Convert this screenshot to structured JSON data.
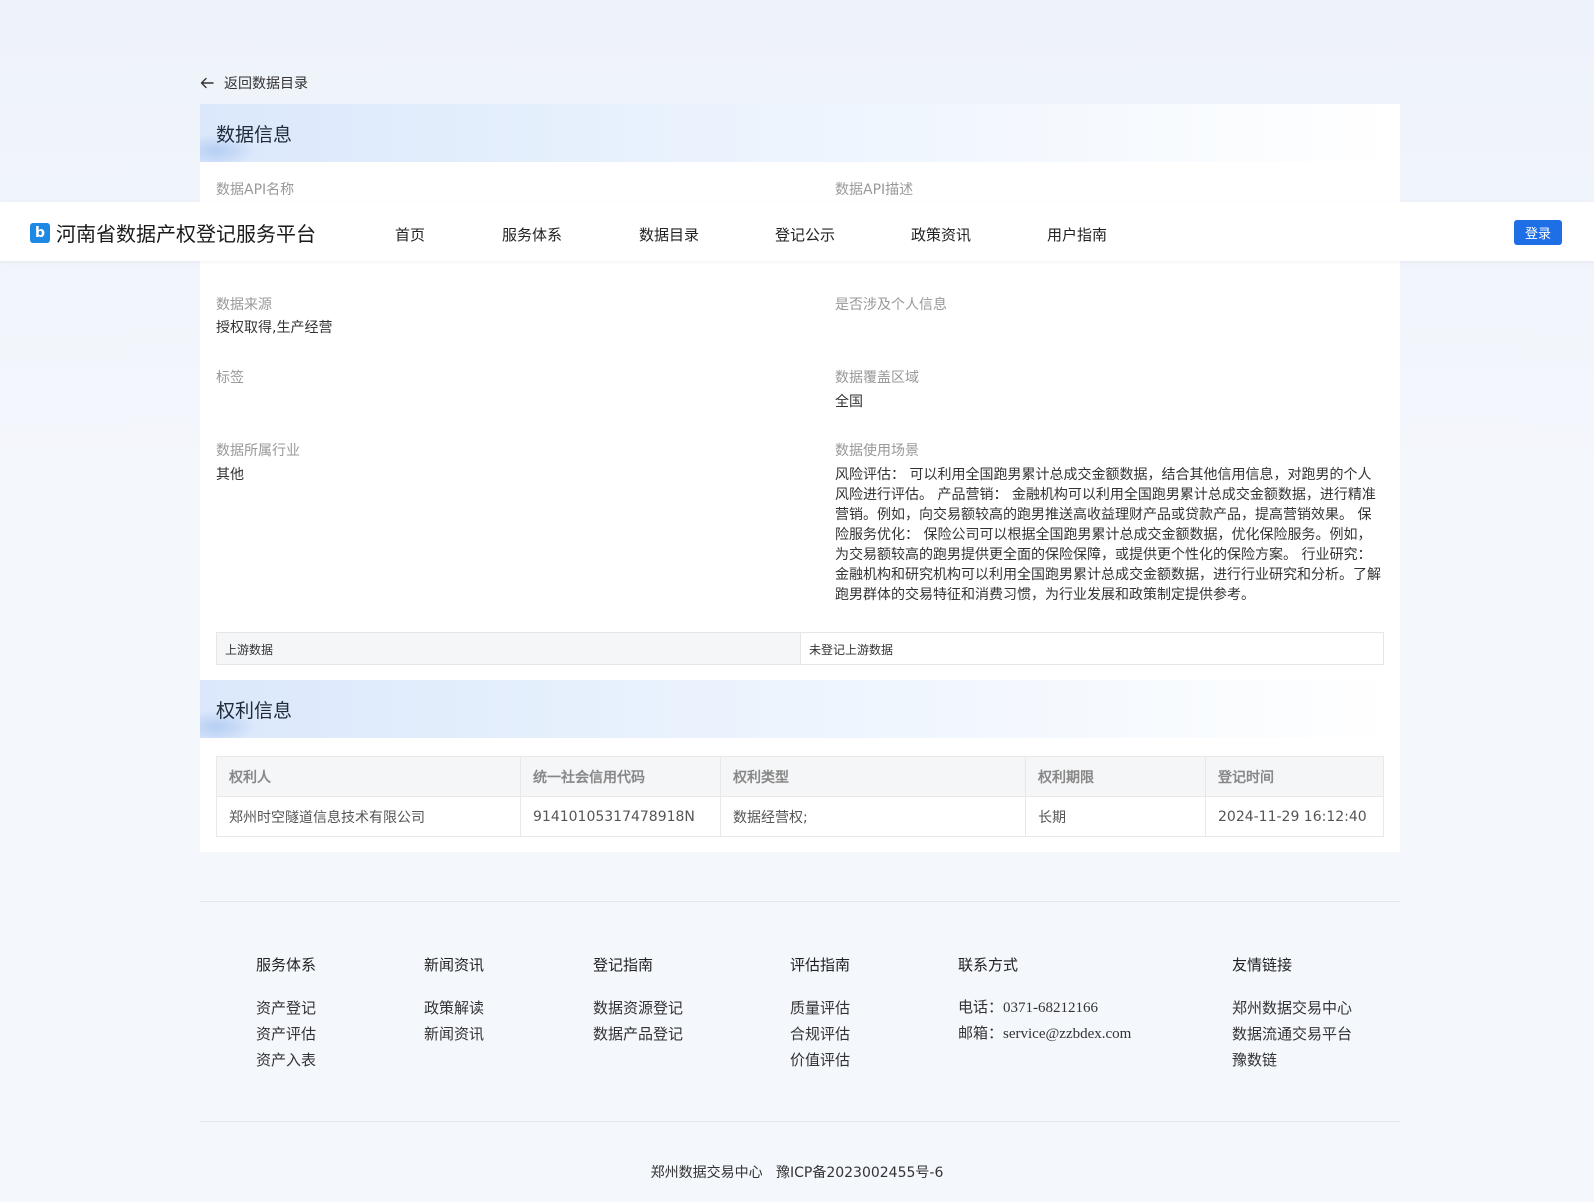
{
  "back_link": "返回数据目录",
  "data_section": {
    "title": "数据信息",
    "api_name_label": "数据API名称",
    "api_desc_label": "数据API描述",
    "source_label": "数据来源",
    "source_value": "授权取得,生产经营",
    "personal_info_label": "是否涉及个人信息",
    "tags_label": "标签",
    "coverage_label": "数据覆盖区域",
    "coverage_value": "全国",
    "industry_label": "数据所属行业",
    "industry_value": "其他",
    "scenario_label": "数据使用场景",
    "scenario_value": "风险评估： 可以利用全国跑男累计总成交金额数据，结合其他信用信息，对跑男的个人风险进行评估。 产品营销： 金融机构可以利用全国跑男累计总成交金额数据，进行精准营销。例如，向交易额较高的跑男推送高收益理财产品或贷款产品，提高营销效果。 保险服务优化： 保险公司可以根据全国跑男累计总成交金额数据，优化保险服务。例如，为交易额较高的跑男提供更全面的保险保障，或提供更个性化的保险方案。 行业研究： 金融机构和研究机构可以利用全国跑男累计总成交金额数据，进行行业研究和分析。了解跑男群体的交易特征和消费习惯，为行业发展和政策制定提供参考。",
    "upstream_label": "上游数据",
    "upstream_value": "未登记上游数据"
  },
  "rights_section": {
    "title": "权利信息",
    "columns": [
      "权利人",
      "统一社会信用代码",
      "权利类型",
      "权利期限",
      "登记时间"
    ],
    "rows": [
      [
        "郑州时空隧道信息技术有限公司",
        "91410105317478918N",
        "数据经营权;",
        "长期",
        "2024-11-29 16:12:40"
      ]
    ]
  },
  "navbar": {
    "brand_icon": "b",
    "brand": "河南省数据产权登记服务平台",
    "items": [
      "首页",
      "服务体系",
      "数据目录",
      "登记公示",
      "政策资讯",
      "用户指南"
    ],
    "login": "登录"
  },
  "footer": {
    "columns": [
      {
        "head": "服务体系",
        "items": [
          "资产登记",
          "资产评估",
          "资产入表"
        ]
      },
      {
        "head": "新闻资讯",
        "items": [
          "政策解读",
          "新闻资讯"
        ]
      },
      {
        "head": "登记指南",
        "items": [
          "数据资源登记",
          "数据产品登记"
        ]
      },
      {
        "head": "评估指南",
        "items": [
          "质量评估",
          "合规评估",
          "价值评估"
        ]
      },
      {
        "head": "联系方式",
        "items": [
          "电话：0371-68212166",
          "邮箱：service@zzbdex.com"
        ]
      },
      {
        "head": "友情链接",
        "items": [
          "郑州数据交易中心",
          "数据流通交易平台",
          "豫数链"
        ]
      }
    ],
    "copyright": "郑州数据交易中心   豫ICP备2023002455号-6"
  },
  "colors": {
    "accent": "#1e6fe6",
    "brand_icon": "#1e88e5"
  }
}
